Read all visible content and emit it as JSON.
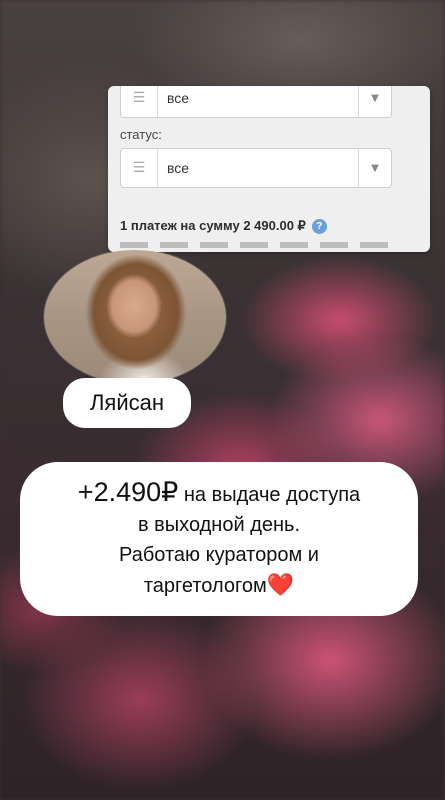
{
  "form": {
    "first_select_value": "все",
    "status_label": "статус:",
    "status_select_value": "все",
    "payment_summary": "1 платеж на сумму 2 490.00 ₽"
  },
  "profile": {
    "name": "Ляйсан"
  },
  "message": {
    "amount": "+2.490₽",
    "line1_rest": " на выдаче доступа",
    "line2": "в выходной день.",
    "line3": "Работаю куратором и",
    "line4": "таргетологом",
    "heart": "❤️"
  },
  "colors": {
    "card_bg": "#efefef",
    "bubble_bg": "#ffffff",
    "heart": "#e3192b",
    "help_icon": "#6aa0dc"
  },
  "icons": [
    "list-icon",
    "chevron-down-icon",
    "help-icon",
    "heart-icon"
  ]
}
